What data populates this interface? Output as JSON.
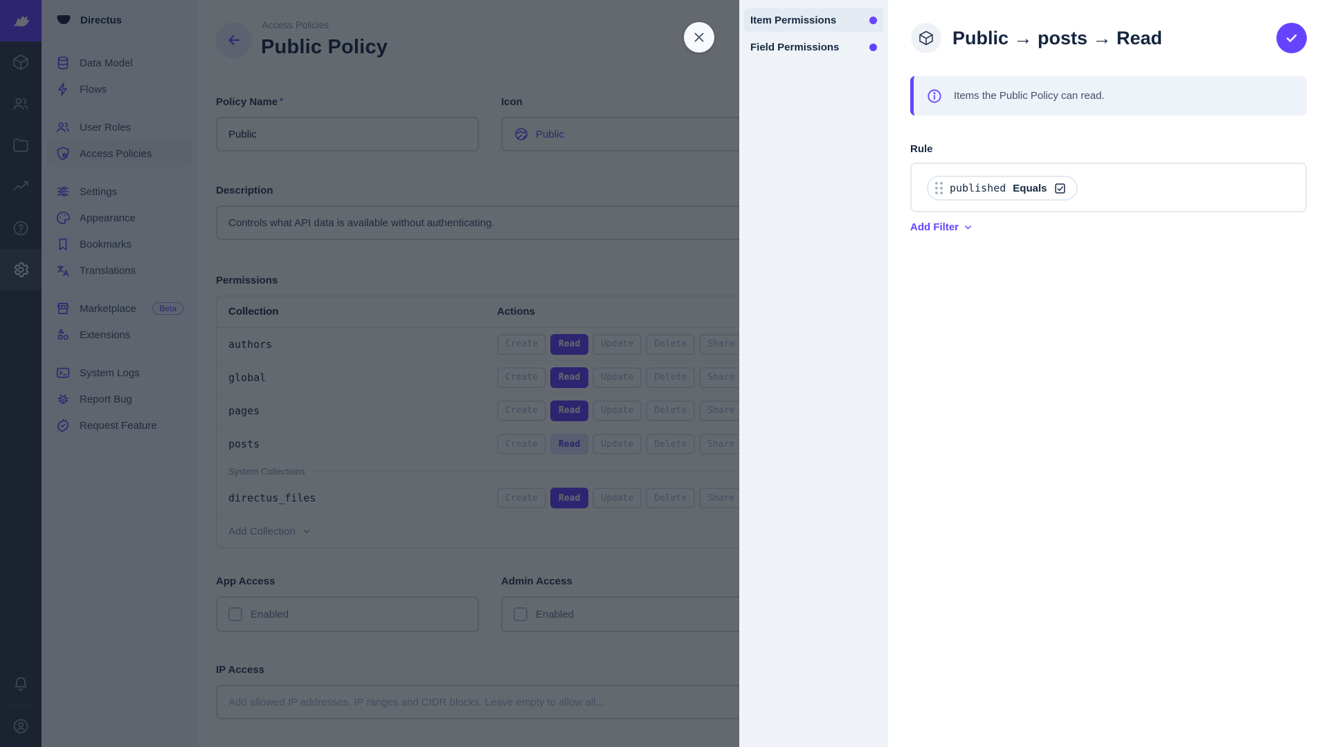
{
  "accent": "#6644FF",
  "module_bar": {
    "logo_icon": "directus-rabbit-icon",
    "modules": [
      {
        "name": "content-module",
        "icon": "cube-icon"
      },
      {
        "name": "users-module",
        "icon": "people-icon"
      },
      {
        "name": "files-module",
        "icon": "folder-icon"
      },
      {
        "name": "insights-module",
        "icon": "activity-icon"
      },
      {
        "name": "docs-module",
        "icon": "help-icon"
      },
      {
        "name": "settings-module",
        "icon": "gear-icon",
        "active": true
      }
    ],
    "bottom": [
      {
        "name": "notifications",
        "icon": "bell-icon"
      },
      {
        "name": "user-menu",
        "icon": "account-circle-icon"
      }
    ]
  },
  "sidebar": {
    "project_name": "Directus",
    "items": [
      {
        "label": "Data Model",
        "icon": "database-icon"
      },
      {
        "label": "Flows",
        "icon": "bolt-icon"
      },
      {
        "label": "User Roles",
        "icon": "people-icon"
      },
      {
        "label": "Access Policies",
        "icon": "shield-user-icon",
        "active": true
      },
      {
        "label": "Settings",
        "icon": "sliders-icon"
      },
      {
        "label": "Appearance",
        "icon": "palette-icon"
      },
      {
        "label": "Bookmarks",
        "icon": "bookmark-icon"
      },
      {
        "label": "Translations",
        "icon": "translate-icon"
      },
      {
        "label": "Marketplace",
        "icon": "storefront-icon",
        "badge": "Beta"
      },
      {
        "label": "Extensions",
        "icon": "shapes-icon"
      },
      {
        "label": "System Logs",
        "icon": "terminal-icon"
      },
      {
        "label": "Report Bug",
        "icon": "bug-icon"
      },
      {
        "label": "Request Feature",
        "icon": "feature-check-icon"
      }
    ]
  },
  "main": {
    "breadcrumb": "Access Policies",
    "title": "Public Policy",
    "policy_name": {
      "label": "Policy Name",
      "required_marker": "*",
      "value": "Public"
    },
    "icon_field": {
      "label": "Icon",
      "value": "Public",
      "icon": "globe-icon"
    },
    "description": {
      "label": "Description",
      "value": "Controls what API data is available without authenticating."
    },
    "permissions": {
      "label": "Permissions",
      "columns": {
        "collection": "Collection",
        "actions": "Actions"
      },
      "actions": [
        "Create",
        "Read",
        "Update",
        "Delete",
        "Share"
      ],
      "rows": [
        {
          "name": "authors",
          "read_state": "full"
        },
        {
          "name": "global",
          "read_state": "full"
        },
        {
          "name": "pages",
          "read_state": "full"
        },
        {
          "name": "posts",
          "read_state": "editing"
        }
      ],
      "system_divider": "System Collections",
      "system_rows": [
        {
          "name": "directus_files",
          "read_state": "full"
        }
      ],
      "add_collection": "Add Collection"
    },
    "app_access": {
      "label": "App Access",
      "checkbox_label": "Enabled",
      "checked": false
    },
    "admin_access": {
      "label": "Admin Access",
      "checkbox_label": "Enabled",
      "checked": false
    },
    "ip_access": {
      "label": "IP Access",
      "placeholder": "Add allowed IP addresses, IP ranges and CIDR blocks. Leave empty to allow all..."
    }
  },
  "drawer": {
    "tabs": [
      {
        "label": "Item Permissions",
        "active": true
      },
      {
        "label": "Field Permissions"
      }
    ],
    "title": "Public → posts → Read",
    "notice": "Items the Public Policy can read.",
    "rule_label": "Rule",
    "filter": {
      "field": "published",
      "operator": "Equals"
    },
    "add_filter_label": "Add Filter"
  }
}
